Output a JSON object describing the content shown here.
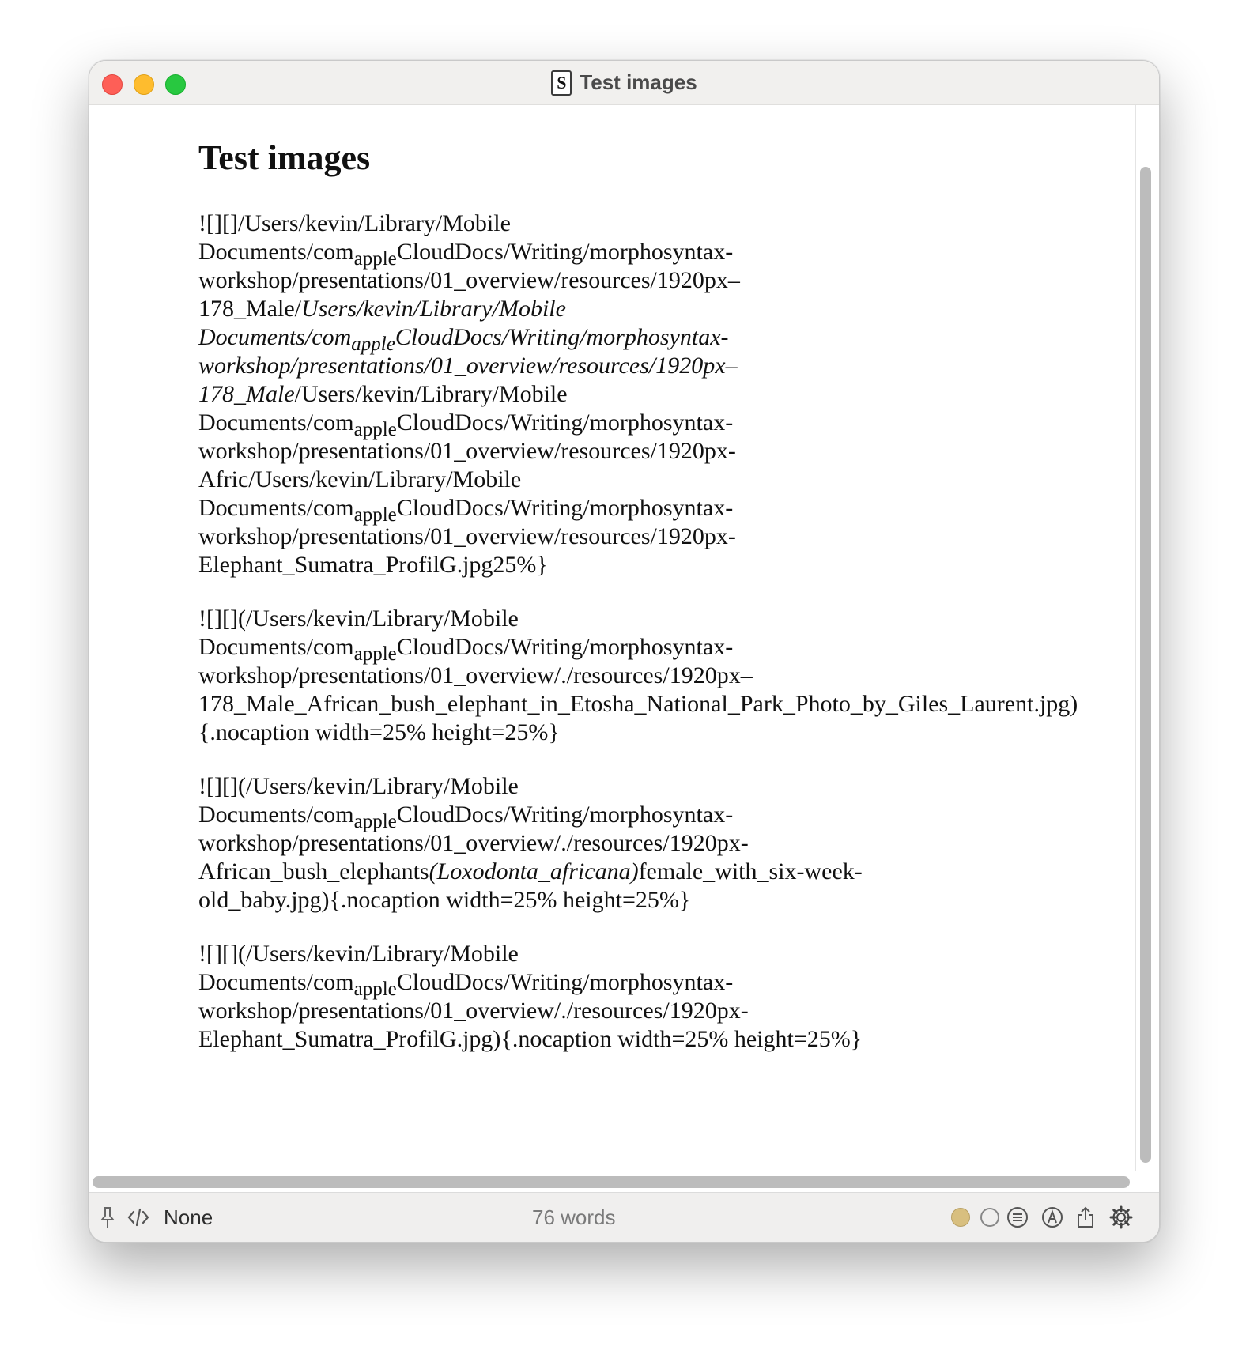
{
  "window": {
    "title": "Test images"
  },
  "document": {
    "heading": "Test images",
    "paragraphs": [
      [
        "![][]/Users/kevin/Library/Mobile",
        [
          "Documents/com",
          {
            "sub": "apple"
          },
          "CloudDocs/Writing/morphosyntax-"
        ],
        "workshop/presentations/01_overview/resources/1920px–",
        [
          "178_Male/",
          {
            "em": "Users/kevin/Library/Mobile"
          }
        ],
        [
          {
            "em": "Documents/com"
          },
          {
            "sub": "apple",
            "em": true
          },
          {
            "em": "CloudDocs/Writing/morphosyntax-"
          }
        ],
        [
          {
            "em": "workshop/presentations/01_overview/resources/1920px–"
          }
        ],
        [
          {
            "em": "178_Male"
          },
          "/Users/kevin/Library/Mobile"
        ],
        [
          "Documents/com",
          {
            "sub": "apple"
          },
          "CloudDocs/Writing/morphosyntax-"
        ],
        "workshop/presentations/01_overview/resources/1920px-",
        "Afric/Users/kevin/Library/Mobile",
        [
          "Documents/com",
          {
            "sub": "apple"
          },
          "CloudDocs/Writing/morphosyntax-"
        ],
        "workshop/presentations/01_overview/resources/1920px-",
        "Elephant_Sumatra_ProfilG.jpg25%}"
      ],
      [
        "![][](/Users/kevin/Library/Mobile",
        [
          "Documents/com",
          {
            "sub": "apple"
          },
          "CloudDocs/Writing/morphosyntax-"
        ],
        "workshop/presentations/01_overview/./resources/1920px–",
        "178_Male_African_bush_elephant_in_Etosha_National_Park_Photo_by_Giles_Laurent.jpg)",
        "{.nocaption width=25% height=25%}"
      ],
      [
        "![][](/Users/kevin/Library/Mobile",
        [
          "Documents/com",
          {
            "sub": "apple"
          },
          "CloudDocs/Writing/morphosyntax-"
        ],
        "workshop/presentations/01_overview/./resources/1920px-",
        [
          "African_bush_elephants",
          {
            "em": "(Loxodonta_africana)"
          },
          "female_with_six-week-"
        ],
        "old_baby.jpg){.nocaption width=25% height=25%}"
      ],
      [
        "![][](/Users/kevin/Library/Mobile",
        [
          "Documents/com",
          {
            "sub": "apple"
          },
          "CloudDocs/Writing/morphosyntax-"
        ],
        "workshop/presentations/01_overview/./resources/1920px-",
        "Elephant_Sumatra_ProfilG.jpg){.nocaption width=25% height=25%}"
      ]
    ]
  },
  "statusbar": {
    "syntax": "None",
    "word_count": "76 words"
  },
  "colors": {
    "close": "#fe5f57",
    "minimize": "#febc2e",
    "maximize": "#28c840",
    "status_dot": "#d8bf7f"
  },
  "icons": [
    "pin-icon",
    "code-icon",
    "status-dot-filled-icon",
    "status-dot-empty-icon",
    "list-icon",
    "markup-icon",
    "share-icon",
    "gear-icon"
  ]
}
